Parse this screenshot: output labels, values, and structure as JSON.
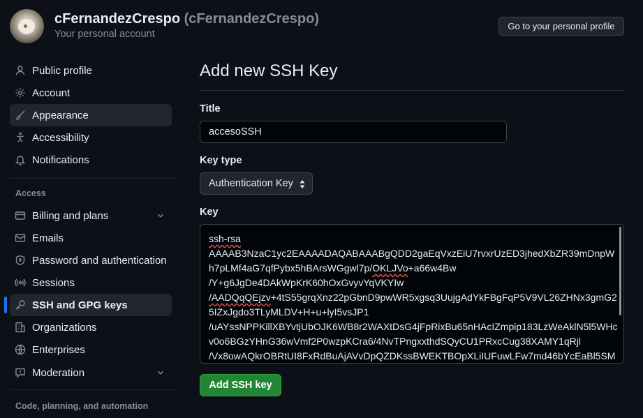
{
  "header": {
    "user_name": "cFernandezCrespo",
    "user_handle": "(cFernandezCrespo)",
    "subtitle": "Your personal account",
    "profile_button": "Go to your personal profile"
  },
  "sidebar": {
    "items_top": [
      {
        "label": "Public profile",
        "icon": "person-icon"
      },
      {
        "label": "Account",
        "icon": "gear-icon"
      },
      {
        "label": "Appearance",
        "icon": "paintbrush-icon"
      },
      {
        "label": "Accessibility",
        "icon": "accessibility-icon"
      },
      {
        "label": "Notifications",
        "icon": "bell-icon"
      }
    ],
    "access_label": "Access",
    "items_access": [
      {
        "label": "Billing and plans",
        "icon": "credit-card-icon",
        "expandable": true
      },
      {
        "label": "Emails",
        "icon": "mail-icon"
      },
      {
        "label": "Password and authentication",
        "icon": "shield-lock-icon"
      },
      {
        "label": "Sessions",
        "icon": "broadcast-icon"
      },
      {
        "label": "SSH and GPG keys",
        "icon": "key-icon",
        "selected": true
      },
      {
        "label": "Organizations",
        "icon": "organization-icon"
      },
      {
        "label": "Enterprises",
        "icon": "globe-icon"
      },
      {
        "label": "Moderation",
        "icon": "report-icon",
        "expandable": true
      }
    ],
    "code_label": "Code, planning, and automation"
  },
  "main": {
    "title": "Add new SSH Key",
    "title_label": "Title",
    "title_value": "accesoSSH",
    "key_type_label": "Key type",
    "key_type_value": "Authentication Key",
    "key_label": "Key",
    "key_prefix": "ssh-rsa",
    "key_line1": "AAAAB3NzaC1yc2EAAAADAQABAAABgQDD2gaEqVxzEiU7rvxrUzED3jhedXbZR39mDnpWh7pLMf4aG7qfPybx5hBArsWGgwl7p/",
    "key_squiggle": "OKLJVo",
    "key_line1_end": "+a66w4Bw",
    "key_line2": "/Y+g6JgDe4DAkWpKrK60hOxGvyvYqVKYIw",
    "key_squiggle2": "/AADQqQEjzv",
    "key_line3": "+4tS55grqXnz22pGbnD9pwWR5xgsq3UujgAdYkFBgFqP5V9VL26ZHNx3gmG25IZxJgdo3TLyMLDV+H+u+lyI5vsJP1",
    "key_line4": "/uAYssNPPKillXBYvtjUbOJK6WB8r2WAXtDsG4jFpRixBu65nHAcIZmpip183LzWeAklN5l5WHcv0o6BGzYHnG36wVmf2P0wzpKCra6/4NvTPngxxthdSQyCU1PRxcCug38XAMY1qRjl",
    "key_line5": "/Vx8owAQkrOBRtUI8FxRdBuAjAVvDpQZDKssBWEKTBOpXLiIUFuwLFw7md46bYcEaBl5SM",
    "submit_label": "Add SSH key"
  },
  "colors": {
    "background": "#0d1117",
    "accent_blue": "#1f6feb",
    "button_green": "#238636"
  }
}
